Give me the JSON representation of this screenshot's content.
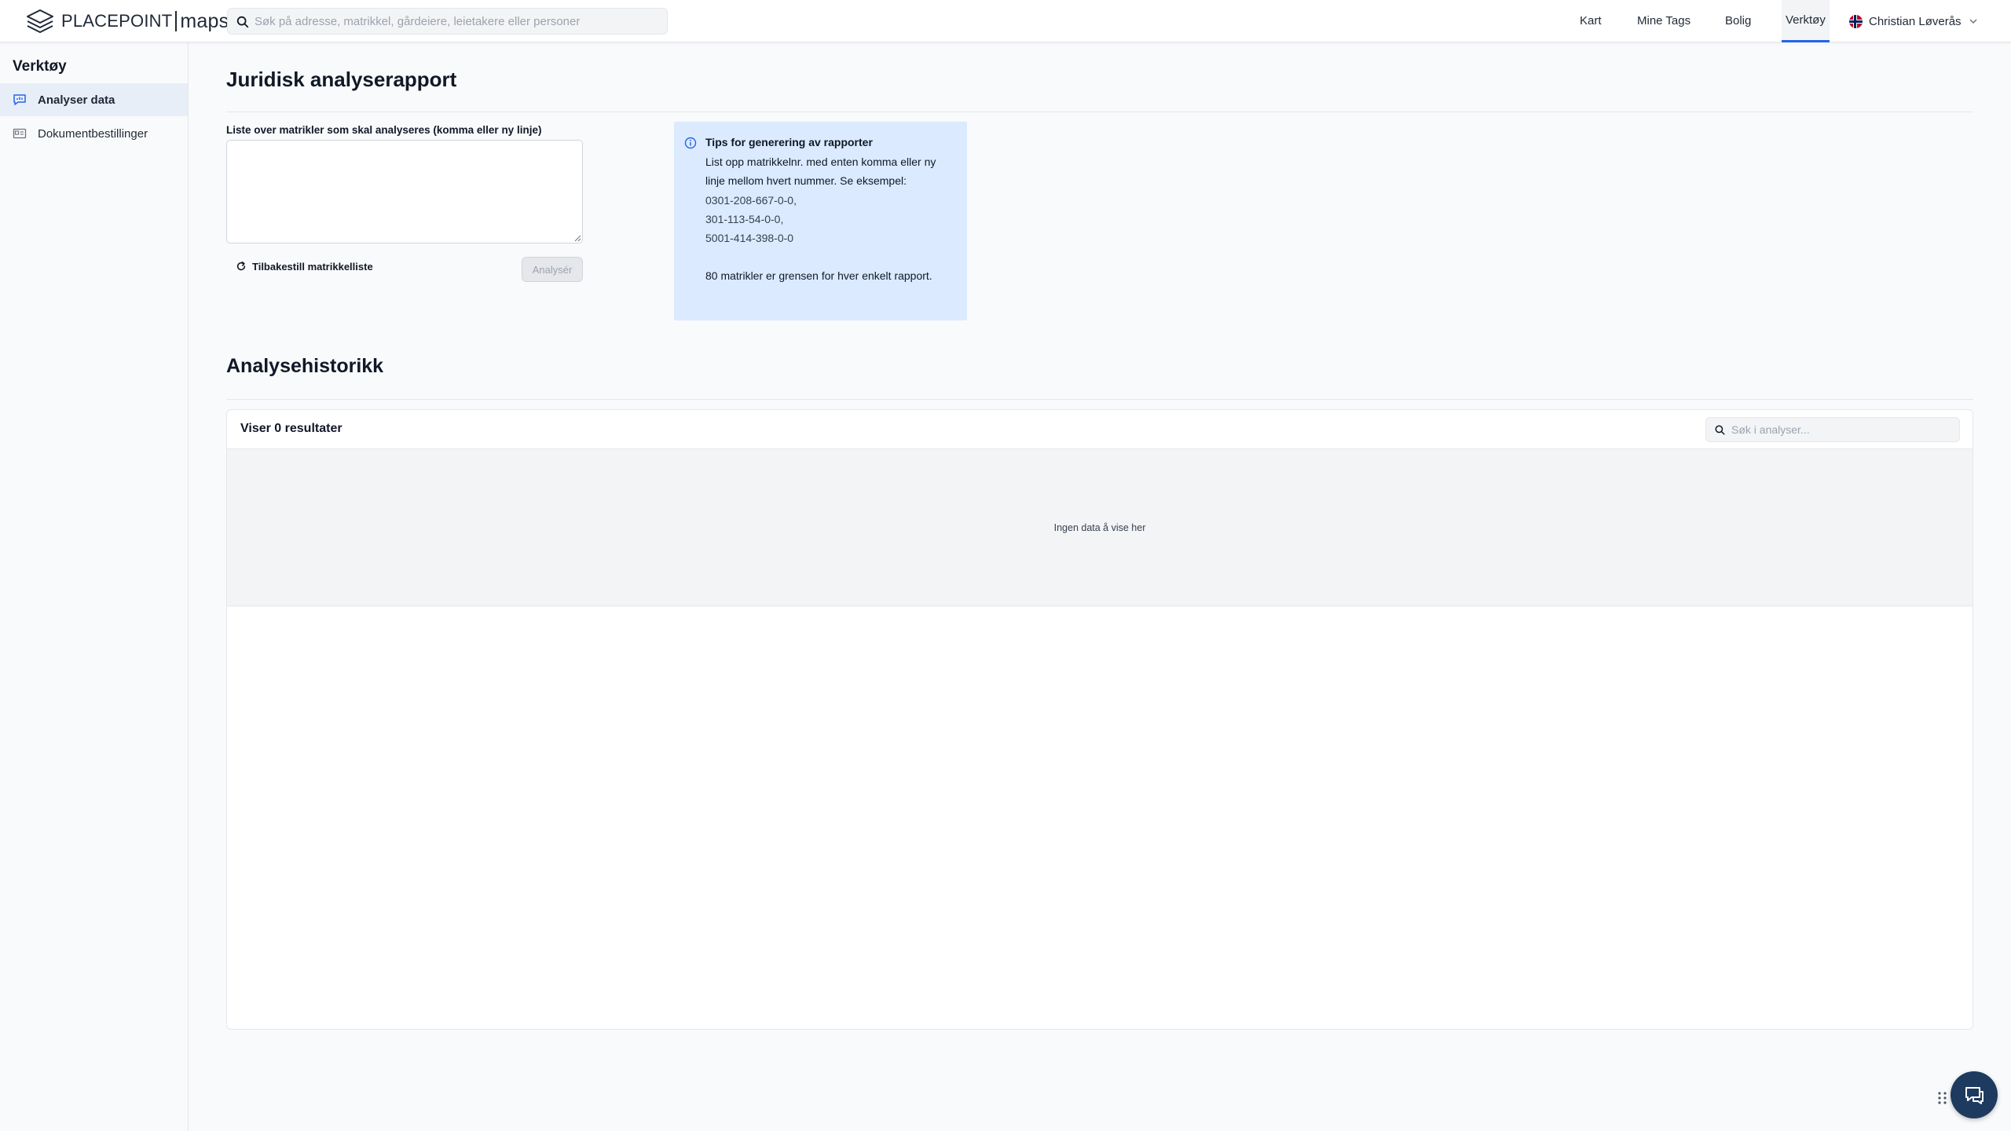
{
  "header": {
    "logo_brand": "PLACEPOINT",
    "logo_product": "maps",
    "search_placeholder": "Søk på adresse, matrikkel, gårdeiere, leietakere eller personer",
    "nav": [
      "Kart",
      "Mine Tags",
      "Bolig",
      "Verktøy"
    ],
    "active_nav": "Verktøy",
    "user_name": "Christian Løverås"
  },
  "sidebar": {
    "title": "Verktøy",
    "items": [
      {
        "label": "Analyser data",
        "icon": "chart-chat-icon",
        "active": true
      },
      {
        "label": "Dokumentbestillinger",
        "icon": "document-card-icon",
        "active": false
      }
    ]
  },
  "report": {
    "title": "Juridisk analyserapport",
    "field_label": "Liste over matrikler som skal analyseres (komma eller ny linje)",
    "textarea_value": "",
    "reset_label": "Tilbakestill matrikkelliste",
    "analyse_label": "Analysér"
  },
  "tips": {
    "title": "Tips for generering av rapporter",
    "text": "List opp matrikkelnr. med enten komma eller ny linje mellom hvert nummer. Se eksempel:",
    "examples": [
      "0301-208-667-0-0,",
      "301-113-54-0-0,",
      "5001-414-398-0-0"
    ],
    "footer": "80 matrikler er grensen for hver enkelt rapport."
  },
  "history": {
    "title": "Analysehistorikk",
    "result_count": "Viser 0 resultater",
    "search_placeholder": "Søk i analyser...",
    "empty_text": "Ingen data å vise her"
  },
  "colors": {
    "accent": "#2563eb",
    "tips_background": "#dbeafe",
    "chat_button": "#1e3a5f"
  }
}
